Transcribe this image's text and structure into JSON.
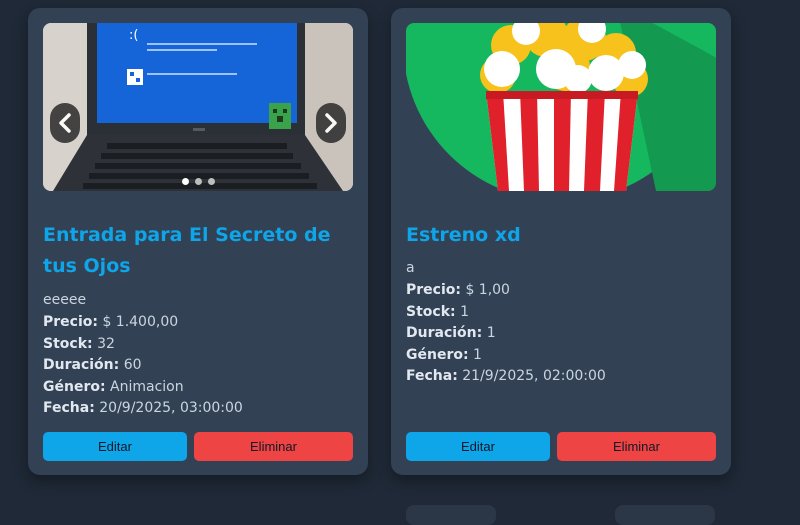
{
  "cards": [
    {
      "title": "Entrada para El Secreto de tus Ojos",
      "description": "eeeee",
      "fields": [
        {
          "label": "Precio:",
          "value": "$ 1.400,00"
        },
        {
          "label": "Stock:",
          "value": "32"
        },
        {
          "label": "Duración:",
          "value": "60"
        },
        {
          "label": "Género:",
          "value": "Animacion"
        },
        {
          "label": "Fecha:",
          "value": "20/9/2025, 03:00:00"
        }
      ],
      "edit_label": "Editar",
      "delete_label": "Eliminar",
      "carousel": {
        "slides": 3,
        "active": 0
      }
    },
    {
      "title": "Estreno xd",
      "description": "a",
      "fields": [
        {
          "label": "Precio:",
          "value": "$ 1,00"
        },
        {
          "label": "Stock:",
          "value": "1"
        },
        {
          "label": "Duración:",
          "value": "1"
        },
        {
          "label": "Género:",
          "value": "1"
        },
        {
          "label": "Fecha:",
          "value": "21/9/2025, 02:00:00"
        }
      ],
      "edit_label": "Editar",
      "delete_label": "Eliminar"
    }
  ],
  "colors": {
    "background": "#1f2937",
    "card": "#334155",
    "title": "#0ea5e9",
    "edit_button": "#0ea5e9",
    "delete_button": "#ef4444"
  },
  "icons": {
    "prev": "chevron-left-icon",
    "next": "chevron-right-icon"
  }
}
